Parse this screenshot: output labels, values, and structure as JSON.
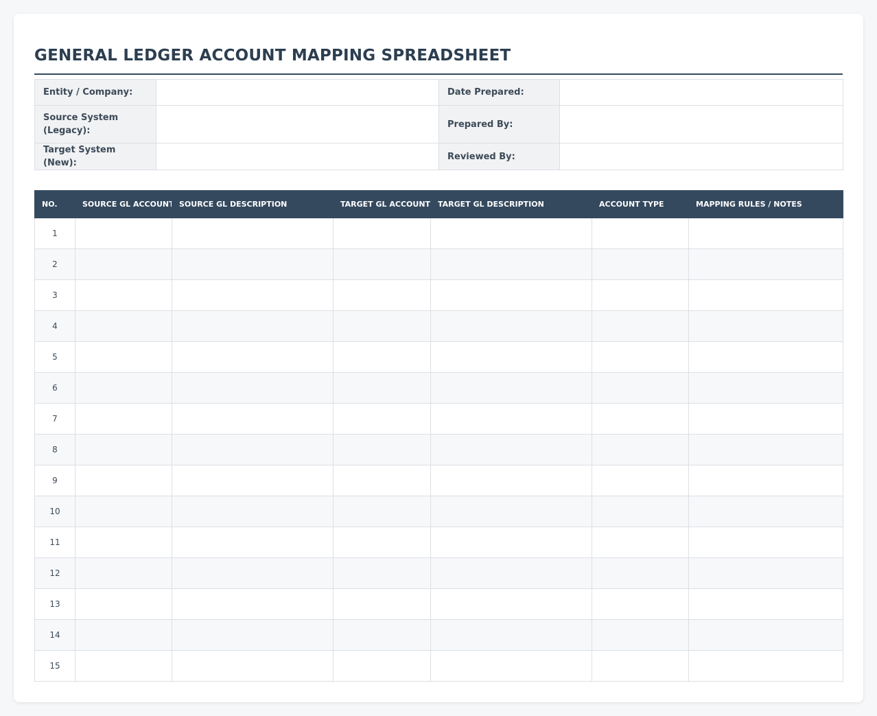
{
  "document": {
    "title": "GENERAL LEDGER ACCOUNT MAPPING SPREADSHEET"
  },
  "meta": {
    "entity_label": "Entity / Company:",
    "entity_value": "",
    "date_label": "Date Prepared:",
    "date_value": "",
    "source_label": "Source System (Legacy):",
    "source_value": "",
    "prepared_label": "Prepared By:",
    "prepared_value": "",
    "target_label": "Target System (New):",
    "target_value": "",
    "reviewed_label": "Reviewed By:",
    "reviewed_value": ""
  },
  "table": {
    "headers": [
      "NO.",
      "SOURCE GL ACCOUNT",
      "SOURCE GL DESCRIPTION",
      "TARGET GL ACCOUNT",
      "TARGET GL DESCRIPTION",
      "ACCOUNT TYPE",
      "MAPPING RULES / NOTES"
    ],
    "rows": [
      {
        "no": "1",
        "source_account": "",
        "source_desc": "",
        "target_account": "",
        "target_desc": "",
        "account_type": "",
        "notes": ""
      },
      {
        "no": "2",
        "source_account": "",
        "source_desc": "",
        "target_account": "",
        "target_desc": "",
        "account_type": "",
        "notes": ""
      },
      {
        "no": "3",
        "source_account": "",
        "source_desc": "",
        "target_account": "",
        "target_desc": "",
        "account_type": "",
        "notes": ""
      },
      {
        "no": "4",
        "source_account": "",
        "source_desc": "",
        "target_account": "",
        "target_desc": "",
        "account_type": "",
        "notes": ""
      },
      {
        "no": "5",
        "source_account": "",
        "source_desc": "",
        "target_account": "",
        "target_desc": "",
        "account_type": "",
        "notes": ""
      },
      {
        "no": "6",
        "source_account": "",
        "source_desc": "",
        "target_account": "",
        "target_desc": "",
        "account_type": "",
        "notes": ""
      },
      {
        "no": "7",
        "source_account": "",
        "source_desc": "",
        "target_account": "",
        "target_desc": "",
        "account_type": "",
        "notes": ""
      },
      {
        "no": "8",
        "source_account": "",
        "source_desc": "",
        "target_account": "",
        "target_desc": "",
        "account_type": "",
        "notes": ""
      },
      {
        "no": "9",
        "source_account": "",
        "source_desc": "",
        "target_account": "",
        "target_desc": "",
        "account_type": "",
        "notes": ""
      },
      {
        "no": "10",
        "source_account": "",
        "source_desc": "",
        "target_account": "",
        "target_desc": "",
        "account_type": "",
        "notes": ""
      },
      {
        "no": "11",
        "source_account": "",
        "source_desc": "",
        "target_account": "",
        "target_desc": "",
        "account_type": "",
        "notes": ""
      },
      {
        "no": "12",
        "source_account": "",
        "source_desc": "",
        "target_account": "",
        "target_desc": "",
        "account_type": "",
        "notes": ""
      },
      {
        "no": "13",
        "source_account": "",
        "source_desc": "",
        "target_account": "",
        "target_desc": "",
        "account_type": "",
        "notes": ""
      },
      {
        "no": "14",
        "source_account": "",
        "source_desc": "",
        "target_account": "",
        "target_desc": "",
        "account_type": "",
        "notes": ""
      },
      {
        "no": "15",
        "source_account": "",
        "source_desc": "",
        "target_account": "",
        "target_desc": "",
        "account_type": "",
        "notes": ""
      }
    ]
  }
}
